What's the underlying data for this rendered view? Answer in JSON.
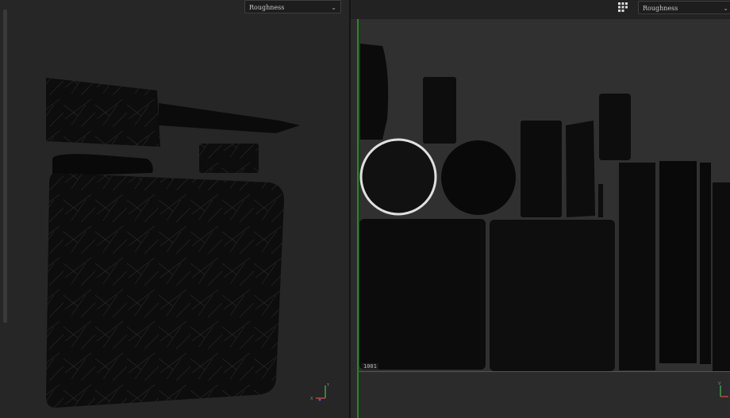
{
  "viewport_3d": {
    "channel_dropdown": {
      "value": "Roughness"
    }
  },
  "viewport_2d": {
    "channel_dropdown": {
      "value": "Roughness"
    },
    "udim_tile_label": "1001",
    "layout_icon": "grid-layout-icon"
  },
  "colors": {
    "background": "#262626",
    "uv_grid_area": "#303030",
    "v_axis": "#1f8f1f",
    "u_axis": "#a83232",
    "texture": "#0b0b0b"
  }
}
